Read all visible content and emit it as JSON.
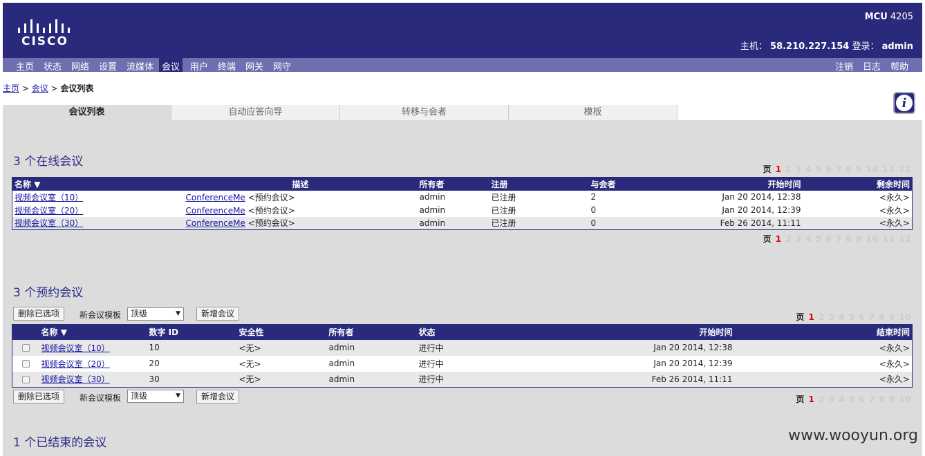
{
  "header": {
    "logo": "CISCO",
    "product_prefix": "MCU",
    "product_model": "4205",
    "host_label": "主机：",
    "host_value": "58.210.227.154",
    "login_label": "登录：",
    "login_value": "admin"
  },
  "nav": {
    "left": [
      "主页",
      "状态",
      "网络",
      "设置",
      "流媒体",
      "会议",
      "用户",
      "终端",
      "网关",
      "网守"
    ],
    "right": [
      "注销",
      "日志",
      "帮助"
    ]
  },
  "breadcrumb": {
    "home": "主页",
    "sep": " > ",
    "conf": "会议",
    "current": "会议列表"
  },
  "tabs": [
    "会议列表",
    "自动应答向导",
    "转移与会者",
    "模板"
  ],
  "online": {
    "title": "3 个在线会议",
    "columns": [
      "名称",
      "描述",
      "所有者",
      "注册",
      "与会者",
      "开始时间",
      "剩余时间"
    ],
    "rows": [
      {
        "name": "视频会议室（10）",
        "desc_link": "ConferenceMe",
        "desc": "<预约会议>",
        "owner": "admin",
        "reg": "已注册",
        "participants": "2",
        "start": "Jan 20 2014, 12:38",
        "remain": "<永久>"
      },
      {
        "name": "视频会议室（20）",
        "desc_link": "ConferenceMe",
        "desc": "<预约会议>",
        "owner": "admin",
        "reg": "已注册",
        "participants": "0",
        "start": "Jan 20 2014, 12:39",
        "remain": "<永久>"
      },
      {
        "name": "视频会议室（30）",
        "desc_link": "ConferenceMe",
        "desc": "<预约会议>",
        "owner": "admin",
        "reg": "已注册",
        "participants": "0",
        "start": "Feb 26 2014, 11:11",
        "remain": "<永久>"
      }
    ]
  },
  "pager_online": {
    "label": "页",
    "current": "1",
    "pages": "2 3 4 5 6 7 8 9 10 11 12"
  },
  "scheduled": {
    "title": "3 个预约会议",
    "delete_label": "删除已选项",
    "template_label": "新会议模板",
    "template_value": "顶级",
    "add_label": "新增会议",
    "columns": [
      "名称",
      "数字 ID",
      "安全性",
      "所有者",
      "状态",
      "开始时间",
      "结束时间"
    ],
    "rows": [
      {
        "name": "视频会议室（10）",
        "id": "10",
        "security": "<无>",
        "owner": "admin",
        "status": "进行中",
        "start": "Jan 20 2014, 12:38",
        "end": "<永久>"
      },
      {
        "name": "视频会议室（20）",
        "id": "20",
        "security": "<无>",
        "owner": "admin",
        "status": "进行中",
        "start": "Jan 20 2014, 12:39",
        "end": "<永久>"
      },
      {
        "name": "视频会议室（30）",
        "id": "30",
        "security": "<无>",
        "owner": "admin",
        "status": "进行中",
        "start": "Feb 26 2014, 11:11",
        "end": "<永久>"
      }
    ]
  },
  "pager_sched": {
    "label": "页",
    "current": "1",
    "pages": "2 3 4 5 6 7 8 9 10"
  },
  "ended": {
    "title": "1 个已结束的会议"
  },
  "watermark": "www.wooyun.org"
}
